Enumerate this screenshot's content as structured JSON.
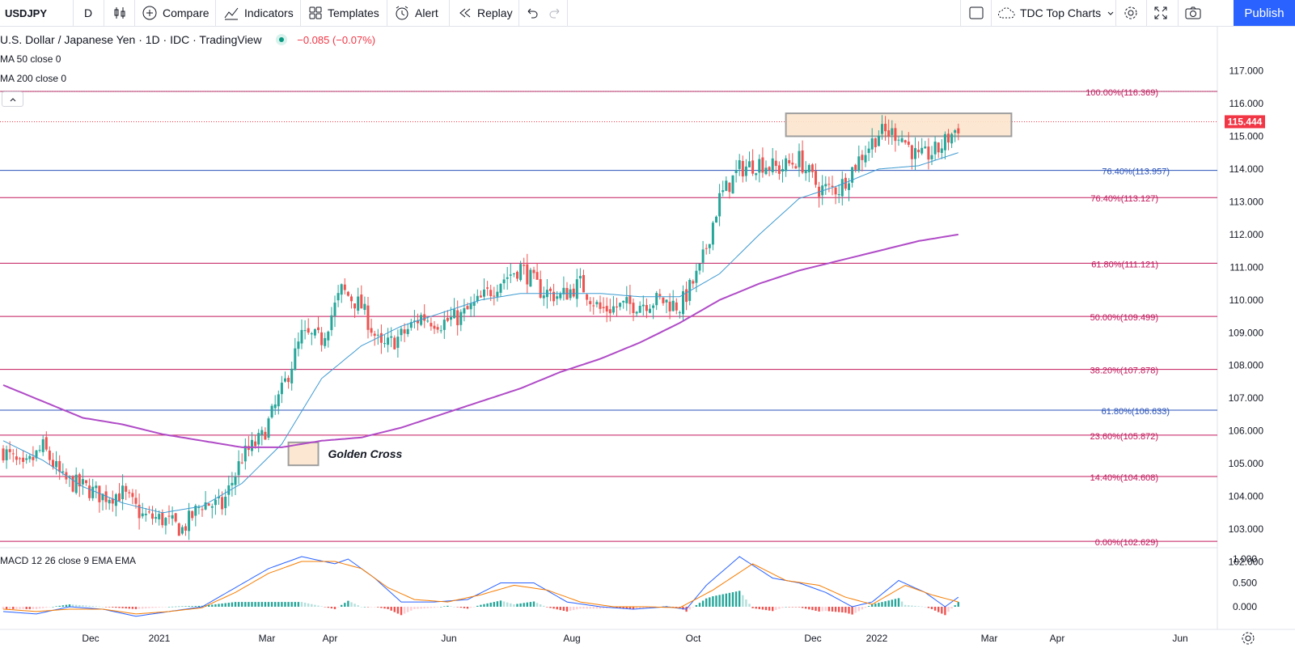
{
  "toolbar": {
    "symbol": "USDJPY",
    "interval": "D",
    "compare_label": "Compare",
    "indicators_label": "Indicators",
    "templates_label": "Templates",
    "alert_label": "Alert",
    "replay_label": "Replay",
    "layout_name": "TDC Top Charts",
    "publish_label": "Publish"
  },
  "legend": {
    "title": "U.S. Dollar / Japanese Yen · 1D · IDC · TradingView",
    "change": "−0.085 (−0.07%)",
    "ma50": "MA 50 close 0",
    "ma200": "MA 200 close 0",
    "macd": "MACD 12 26 close 9 EMA EMA"
  },
  "colors": {
    "up": "#26a69a",
    "down": "#ef5350",
    "ma50": "#3d9ad1",
    "ma200": "#b04bc7",
    "fib_red": "#c2185b",
    "fib_blue": "#2952b8",
    "macd": "#2962ff",
    "signal": "#f57c00",
    "price_tag": "#f23645",
    "accent": "#2962ff"
  },
  "chart_data": {
    "type": "candlestick",
    "title": "U.S. Dollar / Japanese Yen · 1D · IDC · TradingView",
    "last_price": "115.444",
    "ylim": [
      101.9,
      117.4
    ],
    "y_ticks": [
      "117.000",
      "116.000",
      "115.000",
      "114.000",
      "113.000",
      "112.000",
      "111.000",
      "110.000",
      "109.000",
      "108.000",
      "107.000",
      "106.000",
      "105.000",
      "104.000",
      "103.000",
      "102.000"
    ],
    "x_ticks": [
      "Dec",
      "2021",
      "Mar",
      "Apr",
      "Jun",
      "Aug",
      "Oct",
      "Dec",
      "2022",
      "Mar",
      "Apr",
      "Jun"
    ],
    "close_anchors": [
      [
        0,
        105.4
      ],
      [
        6,
        104.8
      ],
      [
        12,
        105.5
      ],
      [
        18,
        104.5
      ],
      [
        24,
        104.3
      ],
      [
        30,
        104.0
      ],
      [
        36,
        104.1
      ],
      [
        42,
        103.4
      ],
      [
        48,
        103.3
      ],
      [
        54,
        103.0
      ],
      [
        60,
        103.8
      ],
      [
        66,
        103.7
      ],
      [
        72,
        105.2
      ],
      [
        78,
        105.8
      ],
      [
        84,
        107.2
      ],
      [
        90,
        108.9
      ],
      [
        96,
        108.8
      ],
      [
        102,
        110.3
      ],
      [
        108,
        109.8
      ],
      [
        114,
        108.5
      ],
      [
        120,
        108.9
      ],
      [
        126,
        109.5
      ],
      [
        132,
        109.3
      ],
      [
        138,
        109.5
      ],
      [
        144,
        110.0
      ],
      [
        150,
        110.6
      ],
      [
        156,
        111.0
      ],
      [
        162,
        110.3
      ],
      [
        168,
        110.1
      ],
      [
        174,
        110.5
      ],
      [
        180,
        109.7
      ],
      [
        186,
        109.8
      ],
      [
        192,
        109.9
      ],
      [
        198,
        110.0
      ],
      [
        204,
        109.8
      ],
      [
        210,
        110.9
      ],
      [
        216,
        113.1
      ],
      [
        222,
        114.0
      ],
      [
        228,
        114.2
      ],
      [
        234,
        114.0
      ],
      [
        240,
        114.3
      ],
      [
        246,
        113.4
      ],
      [
        252,
        113.4
      ],
      [
        258,
        114.3
      ],
      [
        264,
        115.1
      ],
      [
        270,
        115.1
      ],
      [
        276,
        114.3
      ],
      [
        282,
        114.6
      ],
      [
        288,
        115.3
      ]
    ],
    "ma50_anchors": [
      [
        0,
        105.7
      ],
      [
        12,
        105.1
      ],
      [
        24,
        104.3
      ],
      [
        36,
        103.8
      ],
      [
        48,
        103.5
      ],
      [
        60,
        103.7
      ],
      [
        72,
        104.4
      ],
      [
        84,
        105.6
      ],
      [
        96,
        107.6
      ],
      [
        108,
        108.6
      ],
      [
        120,
        109.2
      ],
      [
        132,
        109.6
      ],
      [
        144,
        110.0
      ],
      [
        156,
        110.2
      ],
      [
        168,
        110.2
      ],
      [
        180,
        110.2
      ],
      [
        192,
        110.1
      ],
      [
        204,
        110.1
      ],
      [
        216,
        110.8
      ],
      [
        228,
        112.0
      ],
      [
        240,
        113.1
      ],
      [
        252,
        113.5
      ],
      [
        264,
        114.0
      ],
      [
        276,
        114.1
      ],
      [
        288,
        114.5
      ]
    ],
    "ma200_anchors": [
      [
        0,
        107.4
      ],
      [
        12,
        106.9
      ],
      [
        24,
        106.4
      ],
      [
        36,
        106.2
      ],
      [
        48,
        105.9
      ],
      [
        60,
        105.7
      ],
      [
        72,
        105.5
      ],
      [
        84,
        105.5
      ],
      [
        96,
        105.7
      ],
      [
        108,
        105.8
      ],
      [
        120,
        106.1
      ],
      [
        132,
        106.5
      ],
      [
        144,
        106.9
      ],
      [
        156,
        107.3
      ],
      [
        168,
        107.8
      ],
      [
        180,
        108.2
      ],
      [
        192,
        108.7
      ],
      [
        204,
        109.3
      ],
      [
        216,
        110.0
      ],
      [
        228,
        110.5
      ],
      [
        240,
        110.9
      ],
      [
        252,
        111.2
      ],
      [
        264,
        111.5
      ],
      [
        276,
        111.8
      ],
      [
        288,
        112.0
      ]
    ],
    "fibonacci": [
      {
        "label": "100.00%(116.369)",
        "value": 116.369,
        "color": "red"
      },
      {
        "label": "76.40%(113.957)",
        "value": 113.957,
        "color": "blue"
      },
      {
        "label": "76.40%(113.127)",
        "value": 113.127,
        "color": "red"
      },
      {
        "label": "61.80%(111.121)",
        "value": 111.121,
        "color": "red"
      },
      {
        "label": "50.00%(109.499)",
        "value": 109.499,
        "color": "red"
      },
      {
        "label": "38.20%(107.878)",
        "value": 107.878,
        "color": "red"
      },
      {
        "label": "61.80%(106.633)",
        "value": 106.633,
        "color": "blue"
      },
      {
        "label": "23.60%(105.872)",
        "value": 105.872,
        "color": "red"
      },
      {
        "label": "14.40%(104.608)",
        "value": 104.608,
        "color": "red"
      },
      {
        "label": "0.00%(102.629)",
        "value": 102.629,
        "color": "red"
      }
    ],
    "annotations": [
      {
        "type": "rect",
        "label": "Golden Cross",
        "x_from": 86,
        "x_to": 95,
        "y_from": 104.95,
        "y_to": 105.65
      },
      {
        "type": "rect",
        "label": "",
        "x_from": 236,
        "x_to": 304,
        "y_from": 115.0,
        "y_to": 115.7
      }
    ],
    "macd": {
      "ylim": [
        -0.6,
        1.25
      ],
      "y_ticks": [
        "1.000",
        "0.500",
        "0.000"
      ],
      "macd_anchors": [
        [
          0,
          -0.1
        ],
        [
          10,
          -0.15
        ],
        [
          20,
          0.0
        ],
        [
          30,
          -0.05
        ],
        [
          40,
          -0.2
        ],
        [
          50,
          -0.1
        ],
        [
          60,
          0.0
        ],
        [
          70,
          0.4
        ],
        [
          80,
          0.8
        ],
        [
          90,
          1.05
        ],
        [
          100,
          0.9
        ],
        [
          104,
          1.0
        ],
        [
          112,
          0.6
        ],
        [
          120,
          0.1
        ],
        [
          130,
          0.1
        ],
        [
          140,
          0.15
        ],
        [
          150,
          0.5
        ],
        [
          160,
          0.5
        ],
        [
          170,
          0.1
        ],
        [
          180,
          0.0
        ],
        [
          190,
          -0.05
        ],
        [
          200,
          0.0
        ],
        [
          206,
          -0.05
        ],
        [
          212,
          0.45
        ],
        [
          222,
          1.05
        ],
        [
          232,
          0.6
        ],
        [
          240,
          0.5
        ],
        [
          248,
          0.3
        ],
        [
          256,
          0.0
        ],
        [
          262,
          0.1
        ],
        [
          270,
          0.55
        ],
        [
          278,
          0.3
        ],
        [
          284,
          0.0
        ],
        [
          288,
          0.2
        ]
      ],
      "signal_anchors": [
        [
          0,
          -0.05
        ],
        [
          10,
          -0.1
        ],
        [
          20,
          -0.05
        ],
        [
          30,
          -0.05
        ],
        [
          40,
          -0.15
        ],
        [
          50,
          -0.1
        ],
        [
          60,
          -0.02
        ],
        [
          70,
          0.3
        ],
        [
          80,
          0.7
        ],
        [
          90,
          0.95
        ],
        [
          100,
          0.95
        ],
        [
          108,
          0.8
        ],
        [
          116,
          0.4
        ],
        [
          124,
          0.15
        ],
        [
          134,
          0.1
        ],
        [
          144,
          0.25
        ],
        [
          154,
          0.45
        ],
        [
          164,
          0.35
        ],
        [
          174,
          0.1
        ],
        [
          184,
          0.0
        ],
        [
          194,
          0.0
        ],
        [
          204,
          -0.02
        ],
        [
          214,
          0.35
        ],
        [
          226,
          0.9
        ],
        [
          236,
          0.55
        ],
        [
          246,
          0.45
        ],
        [
          254,
          0.2
        ],
        [
          262,
          0.05
        ],
        [
          272,
          0.45
        ],
        [
          280,
          0.25
        ],
        [
          288,
          0.1
        ]
      ]
    }
  }
}
